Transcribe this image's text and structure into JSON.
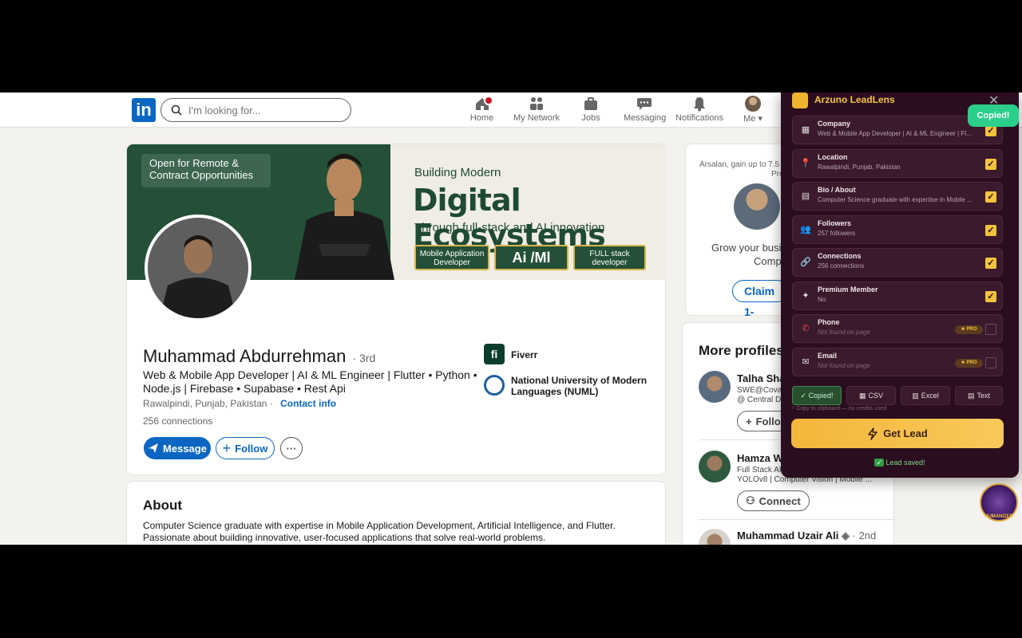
{
  "nav": {
    "search_placeholder": "I'm looking for...",
    "items": [
      {
        "label": "Home",
        "icon": "home-icon"
      },
      {
        "label": "My Network",
        "icon": "network-icon"
      },
      {
        "label": "Jobs",
        "icon": "briefcase-icon"
      },
      {
        "label": "Messaging",
        "icon": "messaging-icon"
      },
      {
        "label": "Notifications",
        "icon": "bell-icon"
      },
      {
        "label": "Me",
        "icon": "avatar"
      }
    ]
  },
  "banner": {
    "tag": "Open for Remote & Contract Opportunities",
    "line1": "Building Modern",
    "line2": "Digital Ecosystems",
    "line3": "Through full-stack and AI innovation",
    "pills": [
      "Mobile Application Developer",
      "Ai /Ml",
      "FULL stack developer"
    ]
  },
  "profile": {
    "name": "Muhammad Abdurrehman",
    "degree": "· 3rd",
    "headline": "Web & Mobile App Developer | AI & ML Engineer | Flutter • Python • Node.js | Firebase • Supabase • Rest Api",
    "location": "Rawalpindi, Punjab, Pakistan",
    "contact": "Contact info",
    "connections": "256 connections",
    "message": "Message",
    "follow": "Follow",
    "more": "···",
    "orgs": [
      "Fiverr",
      "National University of Modern Languages (NUML)"
    ]
  },
  "about": {
    "title": "About",
    "text": "Computer Science graduate with expertise in Mobile Application Development, Artificial Intelligence, and Flutter. Passionate about building innovative, user-focused applications that solve real-world problems."
  },
  "sidebar": {
    "promo_line1": "Arsalan, gain up to 7.5",
    "promo_line2": "Pro",
    "grow1": "Grow your busi",
    "grow2": "Comp",
    "claim": "Claim 1-",
    "more_title": "More profiles",
    "recs": [
      {
        "name": "Talha Sha",
        "sub1": "SWE@Covalen",
        "sub2": "@ Central D",
        "action": "Follo"
      },
      {
        "name": "Hamza W",
        "sub1": "Full Stack AI",
        "sub2": "YOLOv8 | Computer Vision | Mobile ...",
        "action": "Connect"
      },
      {
        "name": "Muhammad Uzair Ali",
        "degree": "· 2nd"
      }
    ]
  },
  "extension": {
    "title": "Arzuno LeadLens",
    "toast": "Copied!",
    "fields": [
      {
        "label": "Company",
        "value": "Web & Mobile App Developer | AI & ML Engineer | Fl...",
        "icon": "building-icon",
        "checked": true
      },
      {
        "label": "Location",
        "value": "Rawalpindi, Punjab, Pakistan",
        "icon": "pin-icon",
        "checked": true
      },
      {
        "label": "Bio / About",
        "value": "Computer Science graduate with expertise in Mobile ...",
        "icon": "document-icon",
        "checked": true
      },
      {
        "label": "Followers",
        "value": "257 followers",
        "icon": "followers-icon",
        "checked": true
      },
      {
        "label": "Connections",
        "value": "256 connections",
        "icon": "link-icon",
        "checked": true
      },
      {
        "label": "Premium Member",
        "value": "No",
        "icon": "sparkle-icon",
        "checked": true
      },
      {
        "label": "Phone",
        "value": "Not found on page",
        "icon": "phone-icon",
        "checked": false,
        "pro": "★ PRO"
      },
      {
        "label": "Email",
        "value": "Not found on page",
        "icon": "mail-icon",
        "checked": false,
        "pro": "★ PRO"
      }
    ],
    "exports": [
      "✓ Copied!",
      "CSV",
      "Excel",
      "Text"
    ],
    "export_note": "↑ Copy to clipboard — no credits used",
    "get_lead": "Get Lead",
    "saved": "Lead saved!",
    "floating_label": "HUMANIZER"
  },
  "colors": {
    "linkedin_blue": "#0a66c2",
    "ext_bg": "#2b0d20",
    "ext_accent": "#f3c23b"
  }
}
